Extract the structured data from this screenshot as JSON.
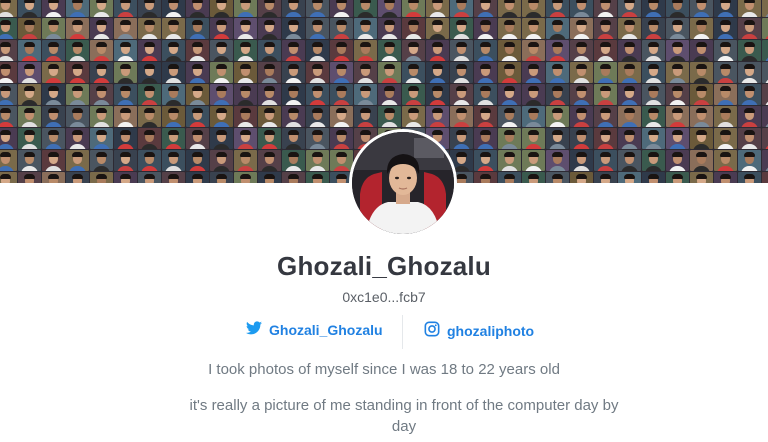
{
  "profile": {
    "username": "Ghozali_Ghozalu",
    "wallet_short": "0xc1e0...fcb7"
  },
  "socials": {
    "twitter_handle": "Ghozali_Ghozalu",
    "instagram_handle": "ghozaliphoto"
  },
  "bio": {
    "line1": "I took photos of myself since I was 18 to 22 years old",
    "line2": "it's really a picture of me standing in front of the computer day by day"
  },
  "colors": {
    "accent": "#2081e2",
    "name_text": "#353840",
    "muted_text": "#707a83"
  },
  "icons": {
    "twitter": "twitter-icon",
    "instagram": "instagram-icon"
  }
}
